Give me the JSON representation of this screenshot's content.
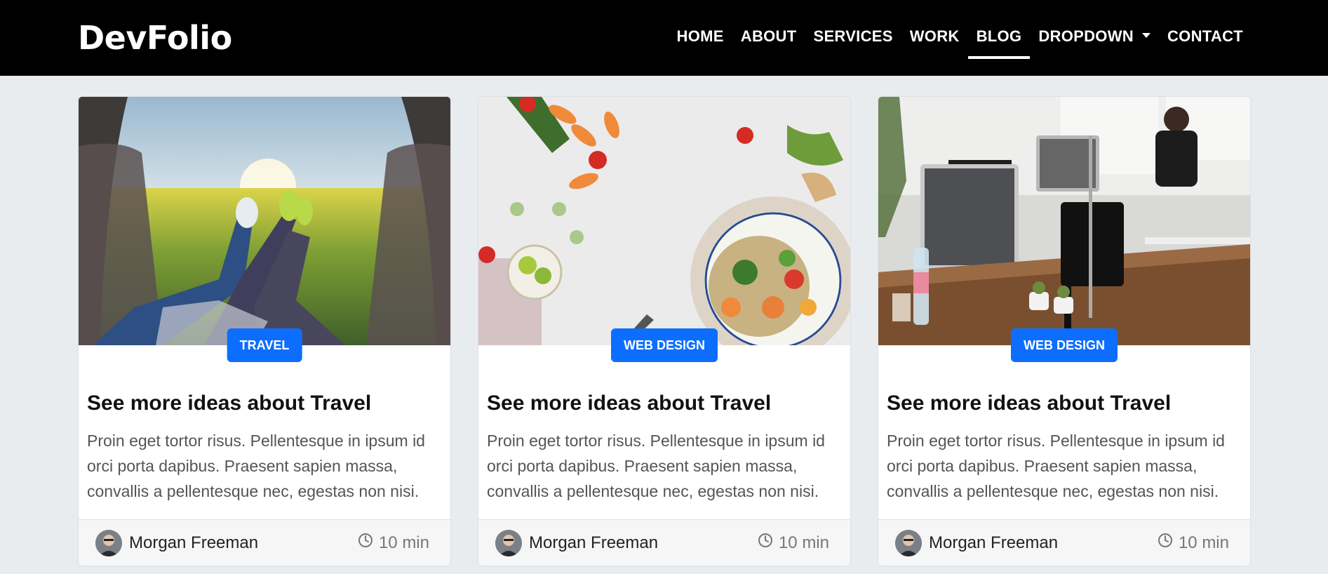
{
  "brand": "DevFolio",
  "nav": [
    "HOME",
    "ABOUT",
    "SERVICES",
    "WORK",
    "BLOG",
    "DROPDOWN",
    "CONTACT"
  ],
  "nav_active": "BLOG",
  "cards": [
    {
      "badge": "TRAVEL",
      "title": "See more ideas about Travel",
      "text": "Proin eget tortor risus. Pellentesque in ipsum id orci porta dapibus. Praesent sapien massa, convallis a pellentesque nec, egestas non nisi.",
      "author": "Morgan Freeman",
      "time": "10 min"
    },
    {
      "badge": "WEB DESIGN",
      "title": "See more ideas about Travel",
      "text": "Proin eget tortor risus. Pellentesque in ipsum id orci porta dapibus. Praesent sapien massa, convallis a pellentesque nec, egestas non nisi.",
      "author": "Morgan Freeman",
      "time": "10 min"
    },
    {
      "badge": "WEB DESIGN",
      "title": "See more ideas about Travel",
      "text": "Proin eget tortor risus. Pellentesque in ipsum id orci porta dapibus. Praesent sapien massa, convallis a pellentesque nec, egestas non nisi.",
      "author": "Morgan Freeman",
      "time": "10 min"
    }
  ],
  "colors": {
    "navbar": "#000000",
    "badge": "#0d6efd",
    "page_bg": "#e9ecef"
  },
  "icons": {
    "clock": "clock-icon",
    "caret": "caret-down-icon"
  }
}
